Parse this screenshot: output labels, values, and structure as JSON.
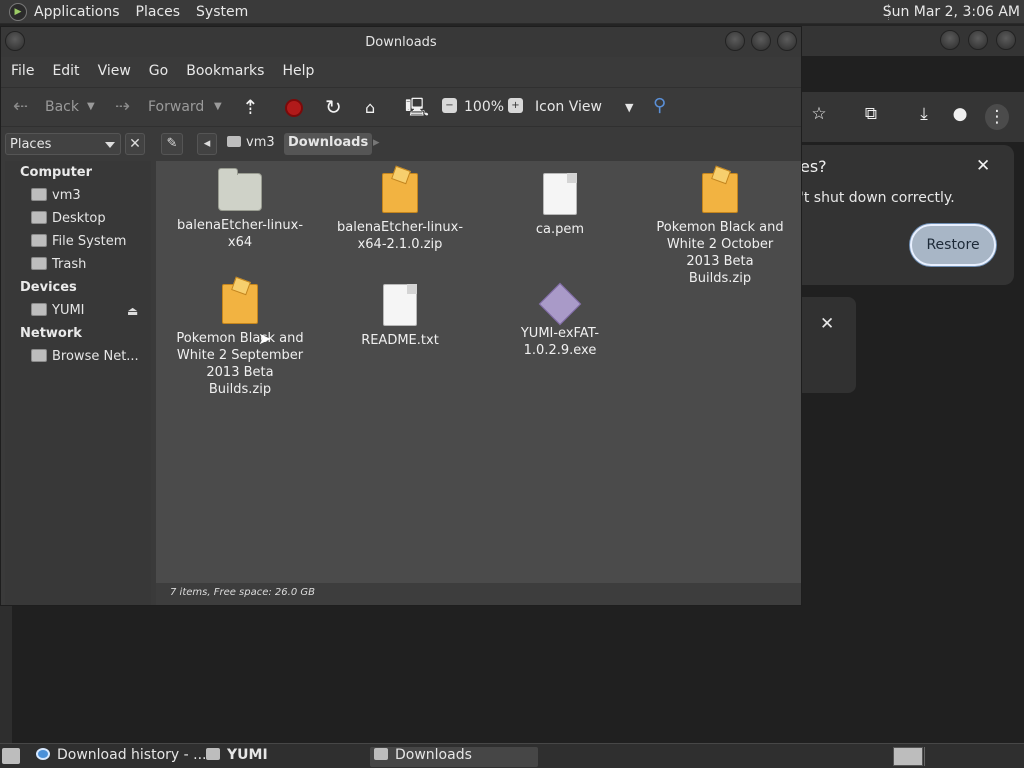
{
  "top_panel": {
    "menus": [
      "Applications",
      "Places",
      "System"
    ],
    "clock": "Sun Mar  2,  3:06 AM"
  },
  "browser_dialog": {
    "title_partial": "es?",
    "message_partial": "'t shut down correctly.",
    "restore_label": "Restore"
  },
  "file_manager": {
    "title": "Downloads",
    "menubar": [
      "File",
      "Edit",
      "View",
      "Go",
      "Bookmarks",
      "Help"
    ],
    "toolbar": {
      "back_label": "Back",
      "forward_label": "Forward",
      "zoom_level": "100%",
      "view_mode": "Icon View"
    },
    "location": {
      "places_label": "Places",
      "crumbs": [
        "vm3",
        "Downloads"
      ]
    },
    "sidebar": {
      "sections": [
        {
          "title": "Computer",
          "items": [
            "vm3",
            "Desktop",
            "File System",
            "Trash"
          ]
        },
        {
          "title": "Devices",
          "items": [
            "YUMI"
          ]
        },
        {
          "title": "Network",
          "items": [
            "Browse Net..."
          ]
        }
      ]
    },
    "files": [
      {
        "name": "balenaEtcher-linux-x64",
        "type": "folder"
      },
      {
        "name": "balenaEtcher-linux-x64-2.1.0.zip",
        "type": "zip"
      },
      {
        "name": "ca.pem",
        "type": "document"
      },
      {
        "name": "Pokemon Black and White 2 October 2013 Beta Builds.zip",
        "type": "zip"
      },
      {
        "name": "Pokemon Black and White 2 September 2013 Beta Builds.zip",
        "type": "zip"
      },
      {
        "name": "README.txt",
        "type": "document"
      },
      {
        "name": "YUMI-exFAT-1.0.2.9.exe",
        "type": "executable"
      }
    ],
    "status": "7 items, Free space: 26.0 GB"
  },
  "taskbar": {
    "tasks": [
      "Download history - ...",
      "YUMI",
      "Downloads"
    ]
  },
  "colors": {
    "panel": "#3a3a3a",
    "window": "#3a3a3a",
    "file_area": "#4b4b4b",
    "restore_button": "#a8b6c6",
    "stop_icon": "#b11a1a"
  }
}
